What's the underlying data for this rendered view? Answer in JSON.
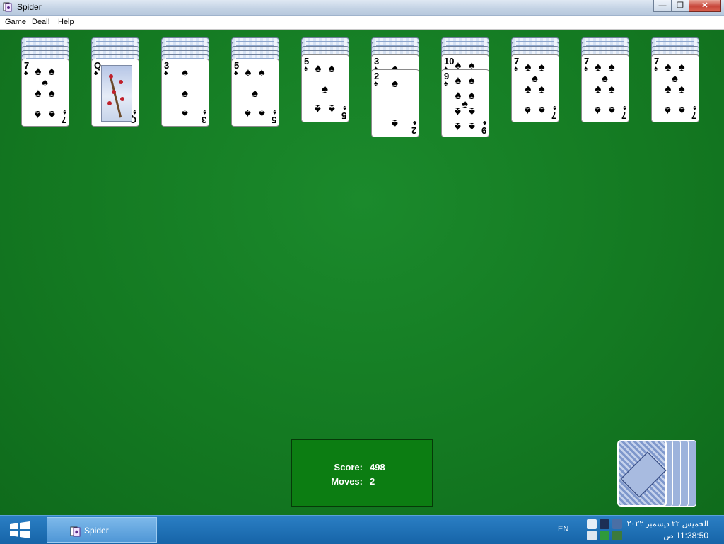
{
  "window": {
    "title": "Spider"
  },
  "menu": {
    "game": "Game",
    "deal": "Deal!",
    "help": "Help"
  },
  "window_buttons": {
    "minimize": "—",
    "restore": "❐",
    "close": "✕"
  },
  "columns": [
    {
      "face_down": 5,
      "cards": [
        {
          "rank": "7",
          "suit": "♠"
        }
      ]
    },
    {
      "face_down": 5,
      "cards": [
        {
          "rank": "Q",
          "suit": "♠"
        }
      ]
    },
    {
      "face_down": 5,
      "cards": [
        {
          "rank": "3",
          "suit": "♠"
        }
      ]
    },
    {
      "face_down": 5,
      "cards": [
        {
          "rank": "5",
          "suit": "♠"
        }
      ]
    },
    {
      "face_down": 4,
      "cards": [
        {
          "rank": "5",
          "suit": "♠"
        }
      ]
    },
    {
      "face_down": 4,
      "cards": [
        {
          "rank": "3",
          "suit": "♠"
        },
        {
          "rank": "2",
          "suit": "♠"
        }
      ]
    },
    {
      "face_down": 4,
      "cards": [
        {
          "rank": "10",
          "suit": "♠"
        },
        {
          "rank": "9",
          "suit": "♠"
        }
      ]
    },
    {
      "face_down": 4,
      "cards": [
        {
          "rank": "7",
          "suit": "♠"
        }
      ]
    },
    {
      "face_down": 4,
      "cards": [
        {
          "rank": "7",
          "suit": "♠"
        }
      ]
    },
    {
      "face_down": 4,
      "cards": [
        {
          "rank": "7",
          "suit": "♠"
        }
      ]
    }
  ],
  "score": {
    "score_label": "Score:",
    "score_value": "498",
    "moves_label": "Moves:",
    "moves_value": "2"
  },
  "stock": {
    "deals_remaining": 5
  },
  "taskbar": {
    "app_label": "Spider",
    "language": "EN",
    "date": "الخميس ٢٢ ديسمبر ٢٠٢٢",
    "time": "11:38:50 ص"
  },
  "colors": {
    "felt": "#147a22",
    "score_box": "#0c7d12",
    "taskbar": "#1c6fb0"
  }
}
